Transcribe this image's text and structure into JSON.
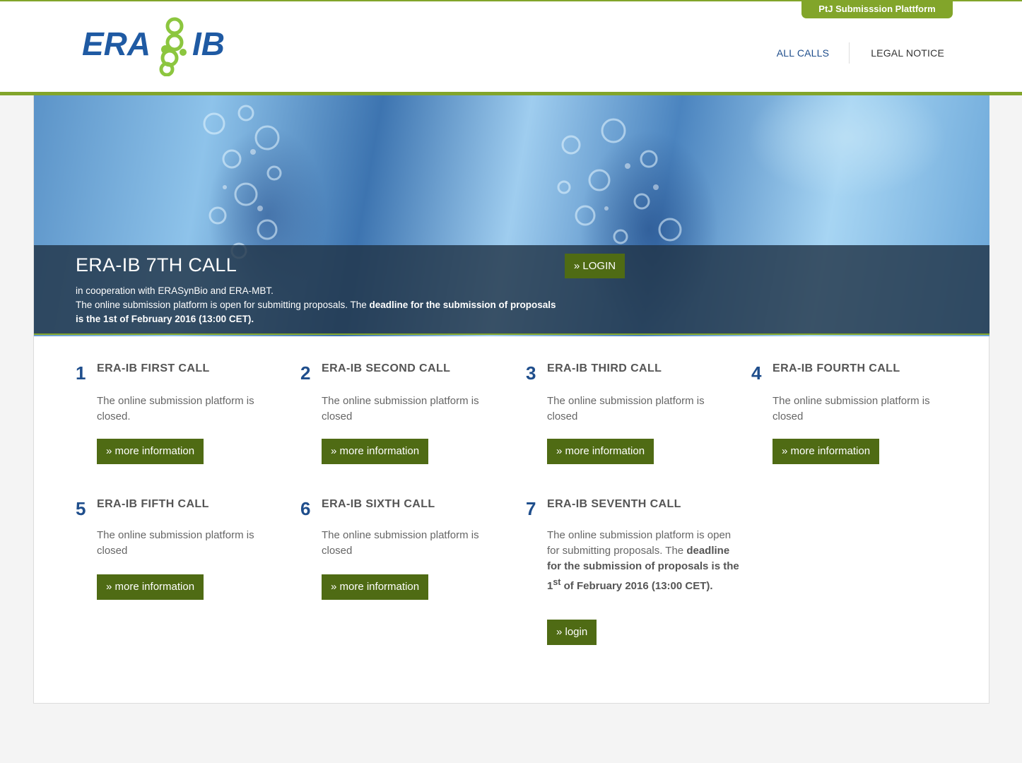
{
  "header": {
    "platform_tab": "PtJ Submisssion Plattform",
    "logo_text_left": "ERA",
    "logo_text_right": "IB",
    "nav": [
      {
        "label": "ALL CALLS"
      },
      {
        "label": "LEGAL NOTICE"
      }
    ]
  },
  "hero": {
    "title": "ERA-IB 7TH CALL",
    "line1": "in cooperation with ERASynBio and ERA-MBT.",
    "line2_plain": "The online submission platform is open for submitting proposals. The ",
    "line2_bold": "deadline for the submission of proposals is the 1st of February 2016 (13:00 CET).",
    "login_label": "» LOGIN"
  },
  "calls": [
    {
      "number": "1",
      "title": "ERA-IB FIRST CALL",
      "desc": "The online submission platform is closed.",
      "button": "» more information"
    },
    {
      "number": "2",
      "title": "ERA-IB SECOND CALL",
      "desc": "The online submission platform is closed",
      "button": "» more information"
    },
    {
      "number": "3",
      "title": "ERA-IB THIRD CALL",
      "desc": "The online submission platform is closed",
      "button": "» more information"
    },
    {
      "number": "4",
      "title": "ERA-IB FOURTH CALL",
      "desc": "The online submission platform is closed",
      "button": "» more information"
    },
    {
      "number": "5",
      "title": "ERA-IB FIFTH CALL",
      "desc": "The online submission platform is closed",
      "button": "» more information"
    },
    {
      "number": "6",
      "title": "ERA-IB SIXTH CALL",
      "desc": "The online submission platform is closed",
      "button": "» more information"
    },
    {
      "number": "7",
      "title": "ERA-IB SEVENTH CALL",
      "desc_plain": "The online submission platform is open for submitting proposals. The ",
      "desc_bold_a": "deadline for the submission of proposals is the 1",
      "desc_sup": "st",
      "desc_bold_b": " of February 2016 (13:00 CET).",
      "button": "» login"
    }
  ],
  "colors": {
    "accent_green": "#82a52a",
    "button_green": "#4f6b14",
    "brand_blue": "#1f4e8c"
  }
}
